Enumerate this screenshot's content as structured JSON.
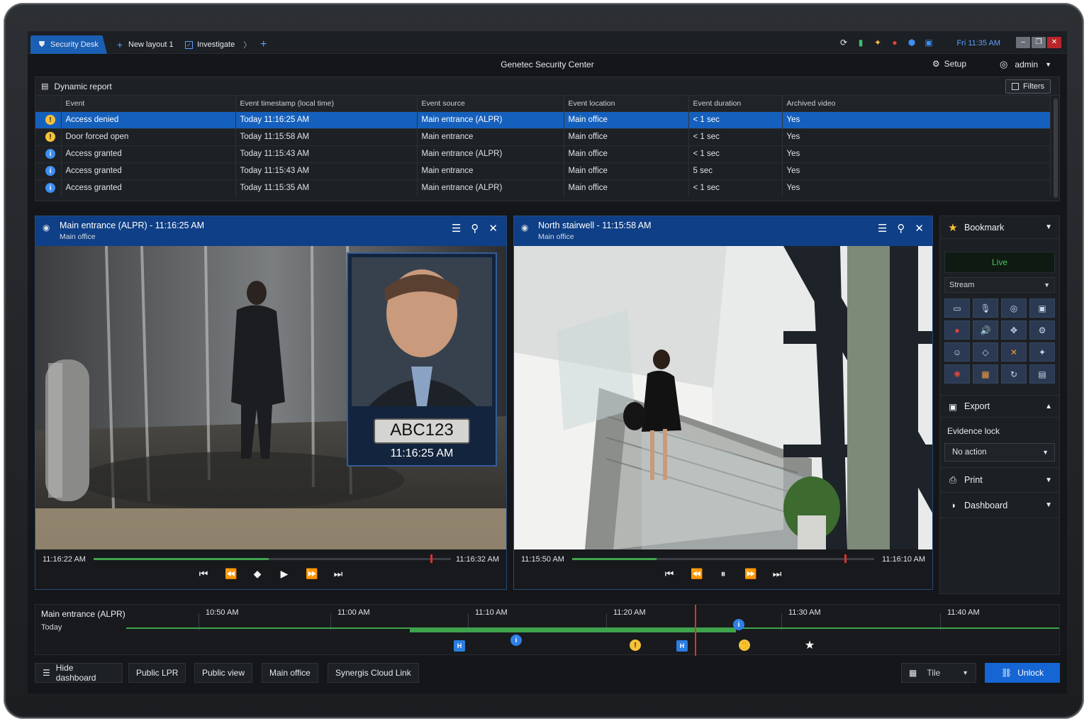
{
  "tabs": [
    {
      "label": "Security Desk",
      "icon": "shield-icon",
      "active": true
    },
    {
      "label": "New layout 1",
      "icon": "plus-icon",
      "active": false
    },
    {
      "label": "Investigate",
      "icon": "investigate-icon",
      "active": false
    }
  ],
  "clock": "Fri 11:35 AM",
  "app_title": "Genetec Security Center",
  "setup_label": "Setup",
  "user_label": "admin",
  "report": {
    "title": "Dynamic report",
    "filters_label": "Filters",
    "columns": [
      "Event",
      "Event timestamp (local time)",
      "Event source",
      "Event location",
      "Event duration",
      "Archived video"
    ],
    "rows": [
      {
        "sev": "warn",
        "event": "Access denied",
        "time": "Today 11:16:25 AM",
        "source": "Main entrance (ALPR)",
        "location": "Main office",
        "duration": "< 1 sec",
        "video": "Yes"
      },
      {
        "sev": "warn",
        "event": "Door forced open",
        "time": "Today 11:15:58 AM",
        "source": "Main entrance",
        "location": "Main office",
        "duration": "< 1 sec",
        "video": "Yes"
      },
      {
        "sev": "info",
        "event": "Access granted",
        "time": "Today 11:15:43 AM",
        "source": "Main entrance (ALPR)",
        "location": "Main office",
        "duration": "< 1 sec",
        "video": "Yes"
      },
      {
        "sev": "info",
        "event": "Access granted",
        "time": "Today 11:15:43 AM",
        "source": "Main entrance",
        "location": "Main office",
        "duration": "5 sec",
        "video": "Yes"
      },
      {
        "sev": "info",
        "event": "Access granted",
        "time": "Today 11:15:35 AM",
        "source": "Main entrance (ALPR)",
        "location": "Main office",
        "duration": "< 1 sec",
        "video": "Yes"
      }
    ]
  },
  "tile1": {
    "title": "Main entrance (ALPR) - 11:16:25 AM",
    "subtitle": "Main office",
    "plate": "ABC123",
    "plate_time": "11:16:25 AM",
    "start": "11:16:22 AM",
    "end": "11:16:32 AM",
    "progress": 0.49
  },
  "tile2": {
    "title": "North stairwell - 11:15:58 AM",
    "subtitle": "Main office",
    "start": "11:15:50 AM",
    "end": "11:16:10 AM",
    "progress": 0.28
  },
  "panel": {
    "bookmark": "Bookmark",
    "live": "Live",
    "stream": "Stream",
    "export": "Export",
    "evidence_lock": "Evidence lock",
    "no_action": "No action",
    "print": "Print",
    "dashboard": "Dashboard"
  },
  "timeline": {
    "camera": "Main entrance (ALPR)",
    "day": "Today",
    "ticks": [
      "10:50 AM",
      "11:00 AM",
      "11:10 AM",
      "11:20 AM",
      "11:30 AM",
      "11:40 AM"
    ]
  },
  "bottom": {
    "hide_dashboard": "Hide dashboard",
    "public_lpr": "Public LPR",
    "public_view": "Public view",
    "main_office": "Main office",
    "synergis": "Synergis Cloud Link",
    "tile": "Tile",
    "unlock": "Unlock"
  },
  "colors": {
    "accent": "#1565d4",
    "selected_row": "#1560bd",
    "tile_header": "#0f3f86",
    "live_green": "#4bc25a"
  }
}
